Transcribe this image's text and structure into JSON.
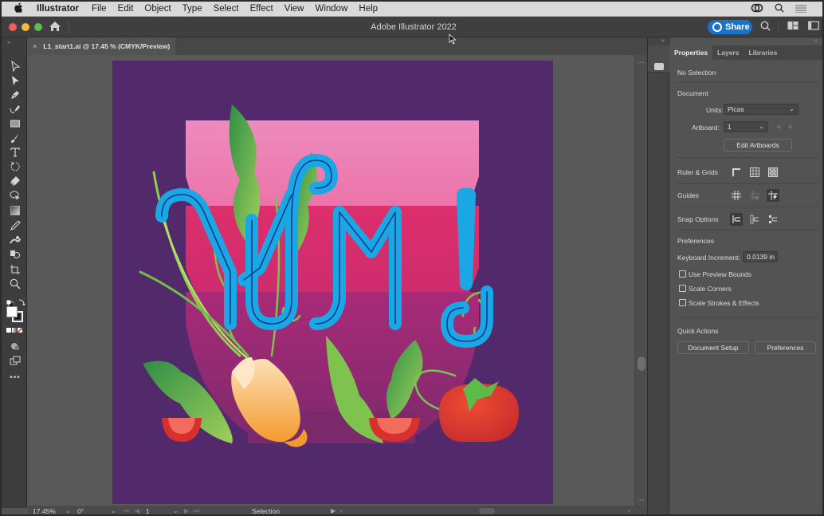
{
  "menubar": {
    "apple_icon": "apple-logo",
    "items": [
      "Illustrator",
      "File",
      "Edit",
      "Object",
      "Type",
      "Select",
      "Effect",
      "View",
      "Window",
      "Help"
    ],
    "status_icons": [
      "creative-cloud-icon",
      "spotlight-search-icon",
      "control-center-icon"
    ]
  },
  "appbar": {
    "title": "Adobe Illustrator 2022",
    "share_label": "Share",
    "icons": [
      "home-icon",
      "search-icon",
      "arrange-documents-icon",
      "workspace-switcher-icon"
    ]
  },
  "document_tab": {
    "close_glyph": "×",
    "label": "L1_start1.ai @ 17.45 % (CMYK/Preview)"
  },
  "toolbar": {
    "tools": [
      "selection-tool",
      "direct-selection-tool",
      "pen-tool",
      "curvature-tool",
      "rectangle-tool",
      "paintbrush-tool",
      "type-tool",
      "rotate-tool",
      "eraser-tool",
      "shape-builder-tool",
      "gradient-tool",
      "eyedropper-tool",
      "blend-tool",
      "symbol-sprayer-tool",
      "artboard-tool",
      "zoom-tool"
    ],
    "fill_color": "#ffffff",
    "stroke_color": "#000000",
    "more_label": "•••"
  },
  "artwork": {
    "headline": "YUM!",
    "background_color": "#522a6b",
    "letter_color": "#1ba6e4",
    "bowl_colors": [
      "#ec86b8",
      "#d9346f",
      "#a52b74"
    ]
  },
  "statusbar": {
    "zoom": "17.45%",
    "rotation": "0°",
    "artboard": "1",
    "tool": "Selection"
  },
  "panel": {
    "tabs": [
      "Properties",
      "Layers",
      "Libraries"
    ],
    "active_tab": "Properties",
    "selection_status": "No Selection",
    "document_heading": "Document",
    "units_label": "Units:",
    "units_value": "Picas",
    "artboard_label": "Artboard:",
    "artboard_value": "1",
    "edit_artboards": "Edit Artboards",
    "ruler_grids": "Ruler & Grids",
    "guides": "Guides",
    "snap_options": "Snap Options",
    "preferences_heading": "Preferences",
    "keyboard_increment_label": "Keyboard Increment:",
    "keyboard_increment_value": "0.0139 in",
    "checkboxes": [
      {
        "label": "Use Preview Bounds",
        "checked": false
      },
      {
        "label": "Scale Corners",
        "checked": false
      },
      {
        "label": "Scale Strokes & Effects",
        "checked": false
      }
    ],
    "quick_actions": "Quick Actions",
    "document_setup": "Document Setup",
    "preferences_button": "Preferences"
  }
}
